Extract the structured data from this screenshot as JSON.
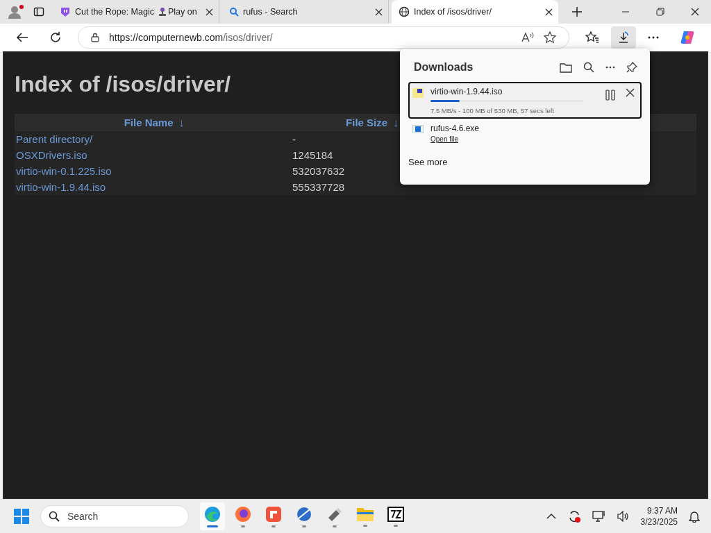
{
  "tabs": [
    {
      "kind": "game",
      "title": "Cut the Rope: Magic",
      "title_rest": "Play on",
      "selected": false
    },
    {
      "kind": "search",
      "title": "rufus - Search",
      "selected": false
    },
    {
      "kind": "site",
      "title": "Index of /isos/driver/",
      "selected": true
    }
  ],
  "address": {
    "host": "https://computernewb.com",
    "path": "/isos/driver/"
  },
  "page": {
    "heading": "Index of /isos/driver/",
    "columns": [
      "File Name  ↓",
      "File Size  ↓"
    ],
    "rows": [
      {
        "name": "Parent directory/",
        "size": "-"
      },
      {
        "name": "OSXDrivers.iso",
        "size": "1245184"
      },
      {
        "name": "virtio-win-0.1.225.iso",
        "size": "532037632"
      },
      {
        "name": "virtio-win-1.9.44.iso",
        "size": "555337728"
      }
    ]
  },
  "downloads": {
    "title": "Downloads",
    "see_more": "See more",
    "items": [
      {
        "kind": "progress",
        "name": "virtio-win-1.9.44.iso",
        "level": 0.19,
        "status": "7.5 MB/s - 100 MB of 530 MB, 57 secs left",
        "selected": true
      },
      {
        "kind": "done",
        "name": "rufus-4.6.exe",
        "action": "Open file",
        "selected": false
      }
    ]
  },
  "taskbar": {
    "search_placeholder": "Search",
    "apps": [
      {
        "kind": "edge",
        "selected": true
      },
      {
        "kind": "firefox",
        "selected": false
      },
      {
        "kind": "red",
        "selected": false
      },
      {
        "kind": "globe",
        "selected": false
      },
      {
        "kind": "usb",
        "selected": false
      },
      {
        "kind": "folder",
        "selected": false
      },
      {
        "kind": "sevenzip",
        "selected": false
      }
    ],
    "time": "9:37 AM",
    "date": "3/23/2025"
  }
}
